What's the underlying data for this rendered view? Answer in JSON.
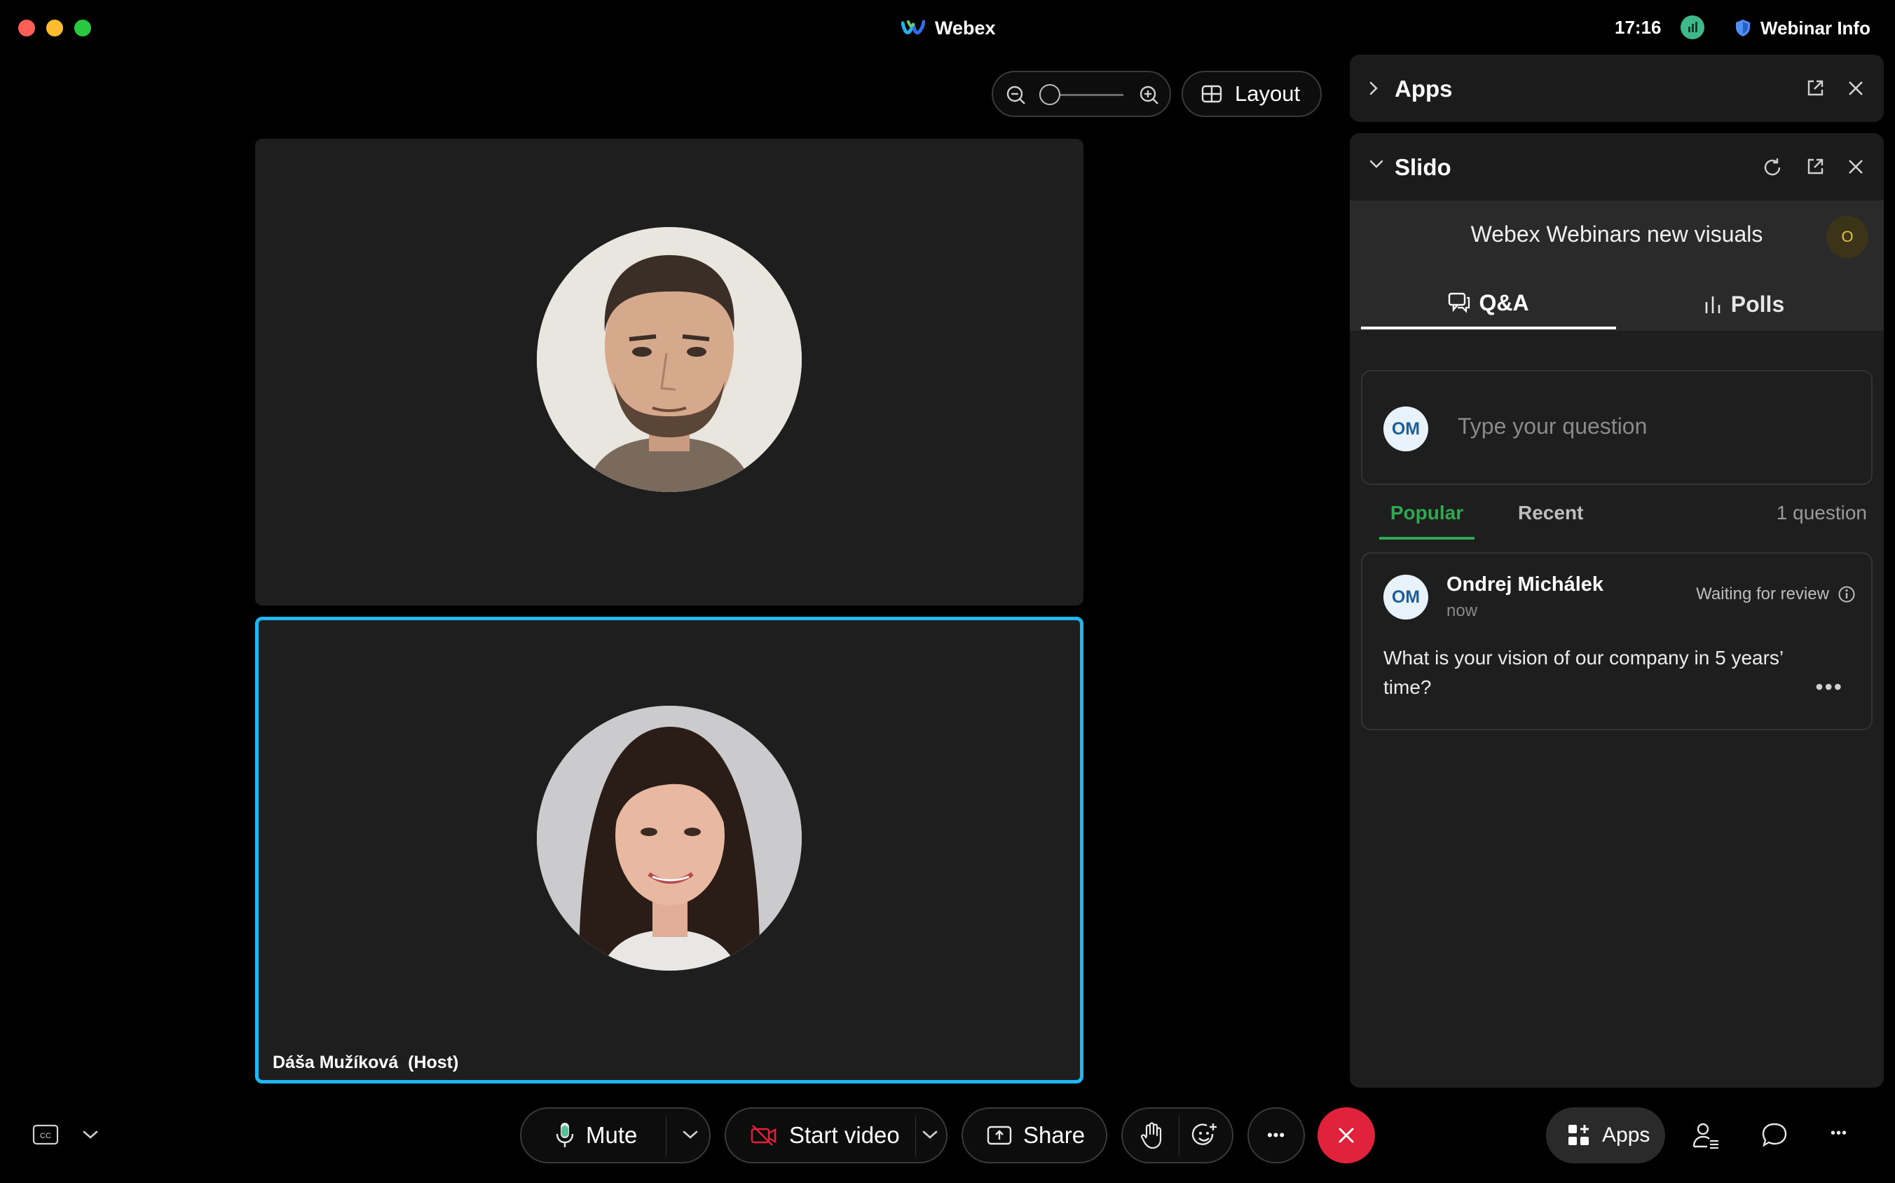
{
  "window": {
    "app_title": "Webex",
    "clock": "17:16",
    "webinar_info_label": "Webinar Info"
  },
  "toolbar_top": {
    "layout_label": "Layout"
  },
  "tiles": [
    {
      "name": ""
    },
    {
      "name": "Dáša Mužíková  (Host)"
    }
  ],
  "apps_panel": {
    "title": "Apps"
  },
  "slido": {
    "title": "Slido",
    "event_title": "Webex Webinars new visuals",
    "user_badge": "O",
    "tabs": [
      {
        "label": "Q&A",
        "active": true
      },
      {
        "label": "Polls",
        "active": false
      }
    ],
    "question_input": {
      "avatar": "OM",
      "placeholder": "Type your question"
    },
    "sort_tabs": [
      {
        "label": "Popular",
        "active": true
      },
      {
        "label": "Recent",
        "active": false
      }
    ],
    "question_count": "1 question",
    "questions": [
      {
        "avatar": "OM",
        "author": "Ondrej Michálek",
        "time": "now",
        "status": "Waiting for review",
        "text": "What is your vision of our company in 5 years’ time?"
      }
    ]
  },
  "bottom_toolbar": {
    "mute_label": "Mute",
    "start_video_label": "Start video",
    "share_label": "Share",
    "apps_label": "Apps"
  },
  "colors": {
    "active_speaker_border": "#1fb6f2",
    "end_call": "#e0233a",
    "popular_accent": "#2fa84f"
  }
}
